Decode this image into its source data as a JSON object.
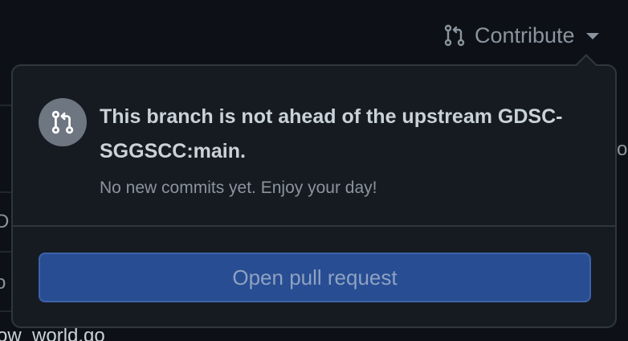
{
  "header": {
    "contribute_label": "Contribute",
    "contribute_icon": "git-pull-request-icon"
  },
  "background": {
    "bottom_text": "ow_world.go",
    "fragments": [
      "o",
      "D",
      "o"
    ]
  },
  "popover": {
    "icon": "git-pull-request-icon",
    "heading": "This branch is not ahead of the upstream GDSC-SGGSCC:main.",
    "subtext": "No new commits yet. Enjoy your day!",
    "button_label": "Open pull request"
  },
  "colors": {
    "page_bg": "#0d1117",
    "popover_bg": "#161b22",
    "border": "#30363d",
    "button_bg": "#284d93",
    "button_text": "#8ea2c2",
    "heading_text": "#c9d1d9",
    "muted_text": "#8b949e"
  }
}
